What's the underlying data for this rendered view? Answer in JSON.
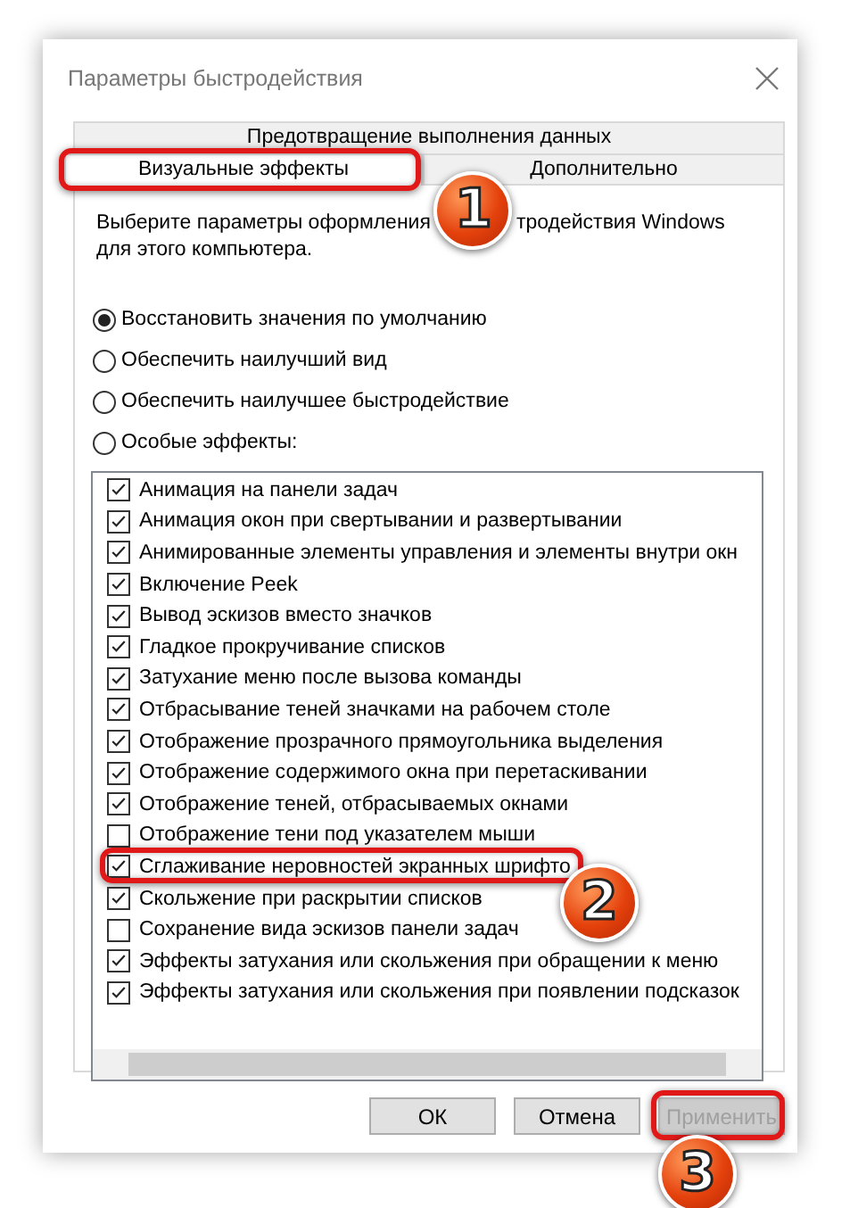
{
  "window": {
    "title": "Параметры быстродействия"
  },
  "tabs_back": [
    {
      "label": "Предотвращение выполнения данных",
      "selected": false
    }
  ],
  "tabs": [
    {
      "label": "Визуальные эффекты",
      "selected": true,
      "callout": "1"
    },
    {
      "label": "Дополнительно",
      "selected": false
    }
  ],
  "description": {
    "line_1_start": "Выберите параметры оформления",
    "line_1_end": "тродействия Windows",
    "line_2": "для этого компьютера."
  },
  "options": [
    {
      "label": "Восстановить значения по умолчанию",
      "selected": true
    },
    {
      "label": "Обеспечить наилучший вид",
      "selected": false
    },
    {
      "label": "Обеспечить наилучшее быстродействие",
      "selected": false
    },
    {
      "label": "Особые эффекты:",
      "selected": false
    }
  ],
  "effects": [
    {
      "label": "Анимация на панели задач",
      "checked": true
    },
    {
      "label": "Анимация окон при свертывании и развертывании",
      "checked": true
    },
    {
      "label": "Анимированные элементы управления и элементы внутри окн",
      "checked": true
    },
    {
      "label": "Включение Peek",
      "checked": true
    },
    {
      "label": "Вывод эскизов вместо значков",
      "checked": true
    },
    {
      "label": "Гладкое прокручивание списков",
      "checked": true
    },
    {
      "label": "Затухание меню после вызова команды",
      "checked": true
    },
    {
      "label": "Отбрасывание теней значками на рабочем столе",
      "checked": true
    },
    {
      "label": "Отображение прозрачного прямоугольника выделения",
      "checked": true
    },
    {
      "label": "Отображение содержимого окна при перетаскивании",
      "checked": true
    },
    {
      "label": "Отображение теней, отбрасываемых окнами",
      "checked": true
    },
    {
      "label": "Отображение тени под указателем мыши",
      "checked": false
    },
    {
      "label": "Сглаживание неровностей экранных шрифто",
      "checked": true,
      "callout": "2"
    },
    {
      "label": "Скольжение при раскрытии списков",
      "checked": true
    },
    {
      "label": "Сохранение вида эскизов панели задач",
      "checked": false
    },
    {
      "label": "Эффекты затухания или скольжения при обращении к меню",
      "checked": true
    },
    {
      "label": "Эффекты затухания или скольжения при появлении подсказок",
      "checked": true
    }
  ],
  "buttons": [
    {
      "label": "ОК",
      "disabled": false
    },
    {
      "label": "Отмена",
      "disabled": false
    },
    {
      "label": "Применить",
      "disabled": true,
      "callout": "3"
    }
  ]
}
